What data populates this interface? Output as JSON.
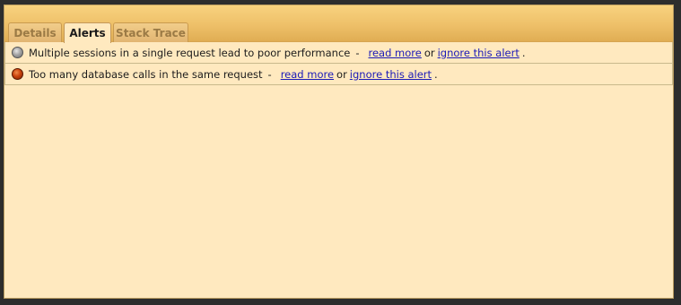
{
  "tabs": [
    {
      "label": "Details",
      "active": false
    },
    {
      "label": "Alerts",
      "active": true
    },
    {
      "label": "Stack Trace",
      "active": false
    }
  ],
  "alerts": [
    {
      "severity_icon": "gray-circle-icon",
      "message": "Multiple sessions in a single request lead to poor performance",
      "separator": "-",
      "read_more": "read more",
      "or": "or",
      "ignore": "ignore this alert",
      "end": "."
    },
    {
      "severity_icon": "red-circle-icon",
      "message": "Too many database calls in the same request",
      "separator": "-",
      "read_more": "read more",
      "or": "or",
      "ignore": "ignore this alert",
      "end": "."
    }
  ],
  "colors": {
    "panel_background": "#ffe9bf",
    "tabstrip": "#eec069",
    "link": "#1a1ab8"
  }
}
